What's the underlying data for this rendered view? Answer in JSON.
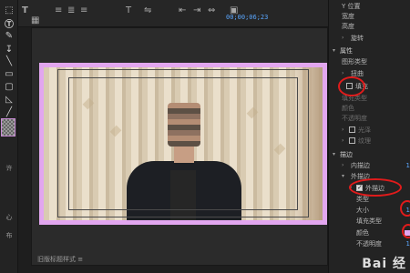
{
  "toolbar": {
    "text_tool": "T",
    "font_size_icon": "T",
    "timecode": "00;00;06;23"
  },
  "tools": {
    "rotate_label": "许",
    "heart_label": "心",
    "layout_label": "布"
  },
  "monitor": {
    "panel_title": "旧版标题样式 ≡"
  },
  "properties": {
    "y_position": "Y 位置",
    "width": "宽度",
    "height": "高度",
    "rotation": "旋转",
    "attributes": "属性",
    "graphic_type": "图形类型",
    "distort": "扭曲",
    "fill_label": "填充",
    "fill_type": "填充类型",
    "color": "颜色",
    "opacity": "不透明度",
    "sheen": "光泽",
    "texture": "纹理",
    "stroke": "描边",
    "inner_stroke": "内描边",
    "outer_stroke": "外描边",
    "outer_stroke_item": "外描边",
    "type": "类型",
    "size": "大小",
    "fill_type2": "填充类型",
    "color2": "颜色",
    "opacity2": "不透明度",
    "val_a": "1",
    "val_b": "1",
    "val_c": "1"
  },
  "watermark": "Bai 经",
  "colors": {
    "accent": "#5aa7ff",
    "frame_border": "#e2a6ef",
    "annotation": "#e01b1b"
  }
}
